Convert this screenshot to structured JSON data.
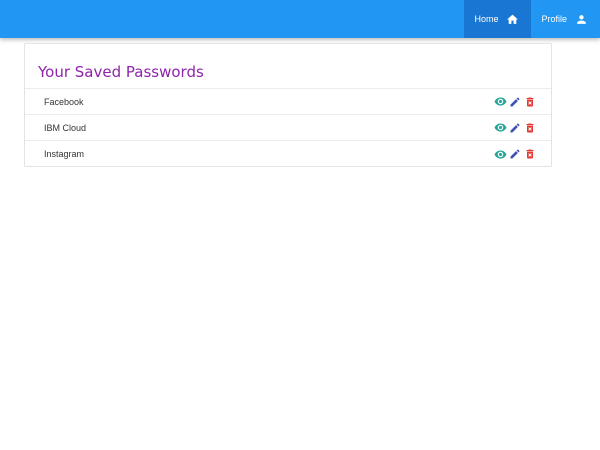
{
  "nav": {
    "home_label": "Home",
    "home_icon": "home-icon",
    "profile_label": "Profile",
    "profile_icon": "person-icon"
  },
  "colors": {
    "appbar": "#2196f3",
    "active_nav": "#1976d2",
    "title": "#8e24aa",
    "view": "#26a69a",
    "edit": "#3f51b5",
    "delete": "#e53935"
  },
  "main": {
    "title": "Your Saved Passwords",
    "items": [
      {
        "label": "Facebook"
      },
      {
        "label": "IBM Cloud"
      },
      {
        "label": "Instagram"
      }
    ],
    "action_icons": [
      "visibility-icon",
      "edit-icon",
      "delete-icon"
    ]
  }
}
